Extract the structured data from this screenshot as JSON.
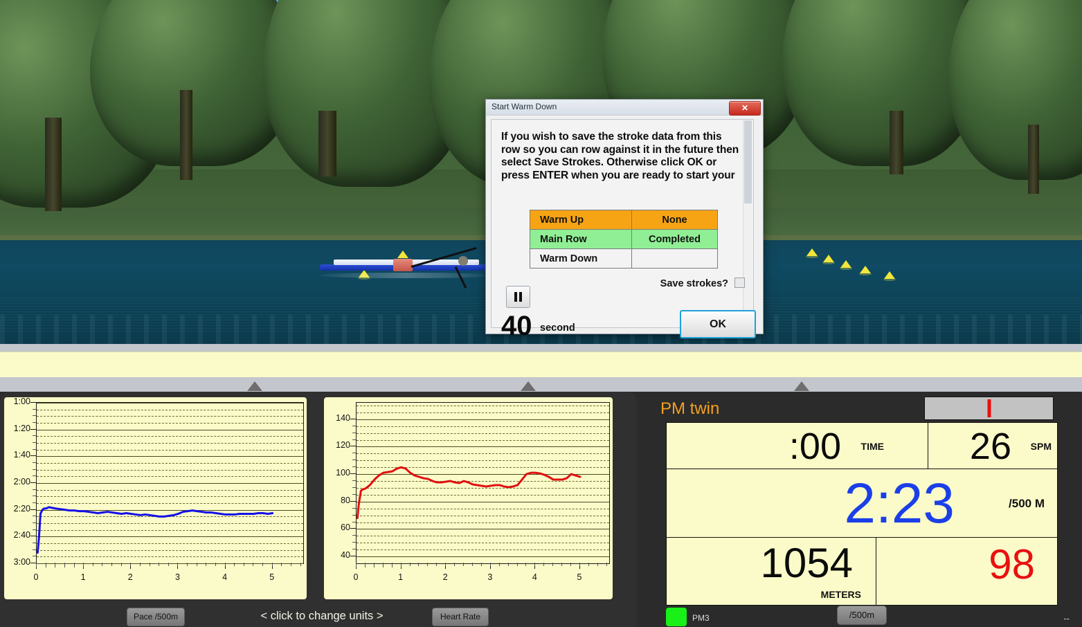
{
  "scene": {
    "description": "rowing simulation river view with pine trees and boat",
    "boat_label": "rowing-shell",
    "buoys": 10
  },
  "dialog": {
    "title": "Start Warm Down",
    "close_label": "✕",
    "message": "If you wish to save the stroke data from this row so you can row against it in the future then select Save Strokes.  Otherwise click OK or press ENTER when you are ready to start your",
    "stages": [
      {
        "name": "Warm Up",
        "status": "None",
        "color": "#f7a414"
      },
      {
        "name": "Main Row",
        "status": "Completed",
        "color": "#90ef94"
      },
      {
        "name": "Warm Down",
        "status": "",
        "color": "#f3f3f3"
      }
    ],
    "save_strokes_label": "Save strokes?",
    "save_strokes_checked": false,
    "pause_label": "⏸",
    "countdown_value": "40",
    "countdown_unit": "second",
    "ok_label": "OK"
  },
  "charts": {
    "left_button_label": "Pace /500m",
    "center_label": "<  click to change units  >",
    "right_button_label": "Heart Rate"
  },
  "chart_data": [
    {
      "type": "line",
      "title": "Pace /500m",
      "xlabel": "",
      "ylabel": "Pace /500m",
      "series_name": "Pace",
      "color": "#1510e8",
      "ytick_labels": [
        "1:00",
        "1:20",
        "1:40",
        "2:00",
        "2:20",
        "2:40",
        "3:00"
      ],
      "ytick_values": [
        60,
        80,
        100,
        120,
        140,
        160,
        180
      ],
      "ylim": [
        60,
        180
      ],
      "y_inverted": true,
      "xtick_labels": [
        "0",
        "1",
        "2",
        "3",
        "4",
        "5"
      ],
      "xlim": [
        0,
        5.65
      ],
      "grid": true,
      "x": [
        0.02,
        0.05,
        0.08,
        0.12,
        0.16,
        0.2,
        0.26,
        0.32,
        0.4,
        0.5,
        0.6,
        0.7,
        0.8,
        0.9,
        1.0,
        1.1,
        1.2,
        1.3,
        1.4,
        1.5,
        1.6,
        1.7,
        1.8,
        1.9,
        2.0,
        2.1,
        2.2,
        2.3,
        2.4,
        2.5,
        2.6,
        2.7,
        2.8,
        2.9,
        3.0,
        3.1,
        3.2,
        3.3,
        3.4,
        3.5,
        3.6,
        3.7,
        3.8,
        3.9,
        4.0,
        4.1,
        4.2,
        4.3,
        4.4,
        4.5,
        4.6,
        4.7,
        4.8,
        4.9,
        5.0
      ],
      "y": [
        172,
        160,
        143,
        140,
        139,
        139,
        138,
        138.5,
        139,
        139.5,
        140,
        140.5,
        140.5,
        141,
        141,
        141.5,
        142,
        142.5,
        142,
        141.5,
        142,
        142.5,
        143,
        142.5,
        143,
        143.5,
        144,
        143.5,
        144,
        144.5,
        145,
        145,
        144.5,
        144,
        143,
        141.5,
        141,
        140.5,
        141,
        141.5,
        142,
        142,
        142.5,
        143,
        143.5,
        143.5,
        143.5,
        143,
        143,
        143,
        143,
        142.5,
        142.5,
        143,
        142.5
      ]
    },
    {
      "type": "line",
      "title": "Heart Rate",
      "xlabel": "",
      "ylabel": "Heart Rate (bpm)",
      "series_name": "Heart Rate",
      "color": "#e01010",
      "ytick_labels": [
        "140",
        "120",
        "100",
        "80",
        "60",
        "40"
      ],
      "ytick_values": [
        140,
        120,
        100,
        80,
        60,
        40
      ],
      "ylim": [
        35,
        152
      ],
      "y_inverted": false,
      "xtick_labels": [
        "0",
        "1",
        "2",
        "3",
        "4",
        "5"
      ],
      "xlim": [
        0,
        5.65
      ],
      "grid": true,
      "x": [
        0.02,
        0.05,
        0.1,
        0.15,
        0.2,
        0.3,
        0.4,
        0.5,
        0.6,
        0.7,
        0.8,
        0.9,
        1.0,
        1.1,
        1.2,
        1.3,
        1.4,
        1.5,
        1.6,
        1.7,
        1.8,
        1.9,
        2.0,
        2.1,
        2.2,
        2.3,
        2.4,
        2.5,
        2.6,
        2.7,
        2.8,
        2.9,
        3.0,
        3.1,
        3.2,
        3.3,
        3.4,
        3.5,
        3.6,
        3.7,
        3.8,
        3.9,
        4.0,
        4.1,
        4.2,
        4.3,
        4.4,
        4.5,
        4.6,
        4.7,
        4.8,
        4.9,
        5.0
      ],
      "y": [
        68,
        78,
        88,
        89,
        89.5,
        92,
        96,
        99,
        101,
        101.5,
        102,
        104,
        105,
        104,
        101,
        99,
        98,
        97,
        96.5,
        95,
        94,
        94,
        94.5,
        95,
        94,
        93.5,
        95,
        94,
        92.5,
        92,
        91.5,
        91,
        91.5,
        92,
        92,
        91,
        90.5,
        91,
        92,
        96,
        100,
        101,
        101,
        100.5,
        99.5,
        98,
        96,
        96,
        96,
        97,
        100,
        99,
        98
      ]
    }
  ],
  "pm": {
    "title": "PM twin",
    "force_indicator": "force-curve",
    "time_value": ":00",
    "time_unit": "TIME",
    "spm_value": "26",
    "spm_unit": "SPM",
    "pace_value": "2:23",
    "pace_unit": "/500 M",
    "meters_value": "1054",
    "meters_unit": "METERS",
    "hr_value": "98",
    "status_device": "PM3",
    "status_unit_button": "/500m",
    "status_dash": "--"
  },
  "colors": {
    "accent_orange": "#f4a01e",
    "pace_blue": "#1a3fe8",
    "hr_red": "#e81010",
    "lcd_bg": "#fbfbc9",
    "panel_dark": "#2b2b2b"
  }
}
